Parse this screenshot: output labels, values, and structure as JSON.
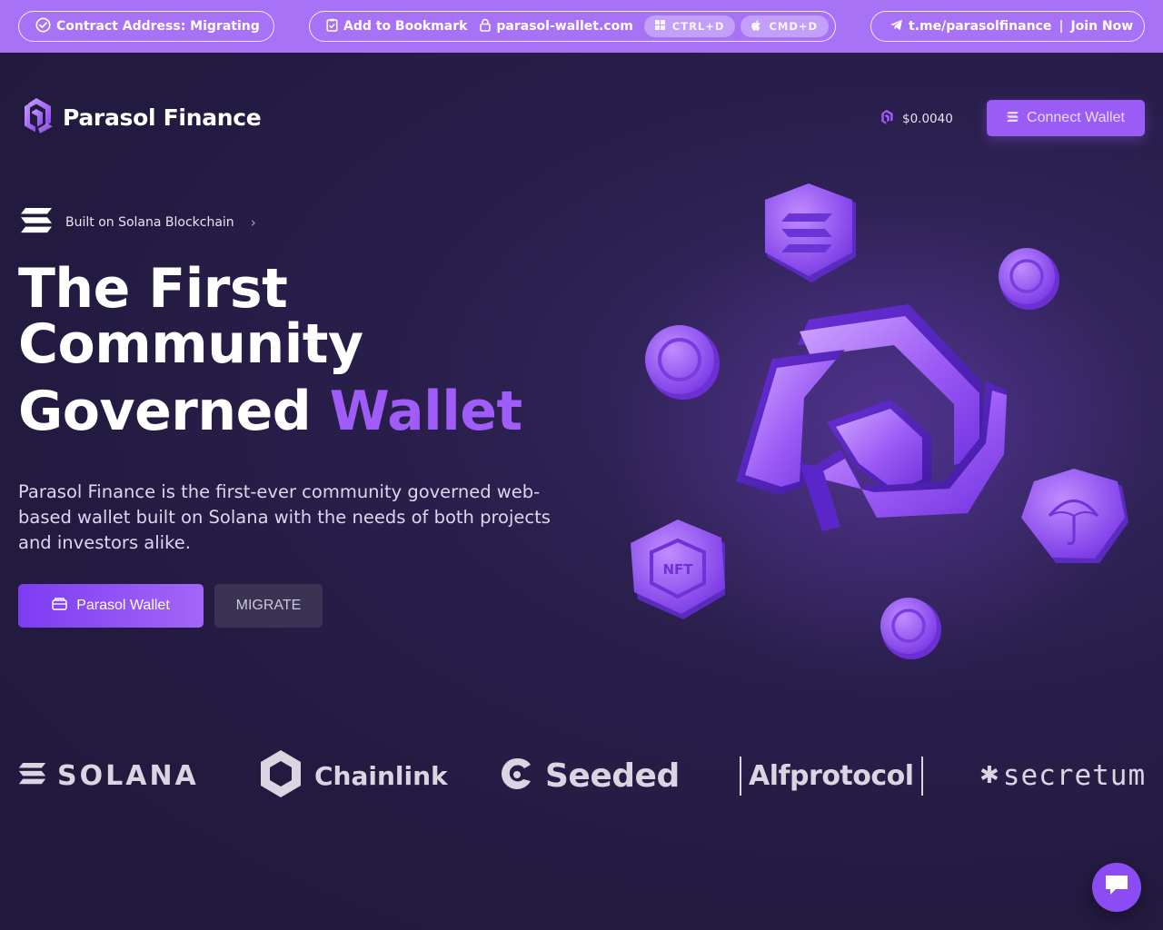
{
  "announcement": {
    "contract_label": "Contract Address: Migrating",
    "bookmark_label": "Add to Bookmark",
    "domain": "parasol-wallet.com",
    "shortcut_windows": "CTRL+D",
    "shortcut_mac": "CMD+D",
    "telegram_link": "t.me/parasolfinance",
    "telegram_sep": "|",
    "telegram_cta": "Join Now"
  },
  "header": {
    "brand_name": "Parasol Finance",
    "token_price": "$0.0040",
    "connect_label": "Connect Wallet"
  },
  "hero": {
    "chip_label": "Built on Solana Blockchain",
    "title_line1": "The First",
    "title_line2": "Community",
    "title_line3_plain": "Governed",
    "title_line3_accent": "Wallet",
    "description": "Parasol Finance is the first-ever community governed web-based wallet built on Solana with the needs of both projects and investors alike.",
    "primary_button": "Parasol Wallet",
    "secondary_button": "MIGRATE"
  },
  "partners": {
    "solana": "SOLANA",
    "chainlink": "Chainlink",
    "seeded": "Seeded",
    "alfprotocol": "Alfprotocol",
    "secretum": "secretum"
  },
  "colors": {
    "accent": "#a05cf8",
    "topbar": "#a772f6",
    "background": "#231a40",
    "button_secondary": "#3a3354"
  },
  "icons": {
    "contract": "check-circle-icon",
    "bookmark": "clipboard-icon",
    "secure": "lock-icon",
    "windows": "windows-icon",
    "apple": "apple-icon",
    "telegram": "telegram-icon",
    "price_token": "parasol-token-icon",
    "connect": "solana-icon",
    "wallet": "wallet-icon",
    "chat": "chat-icon"
  }
}
